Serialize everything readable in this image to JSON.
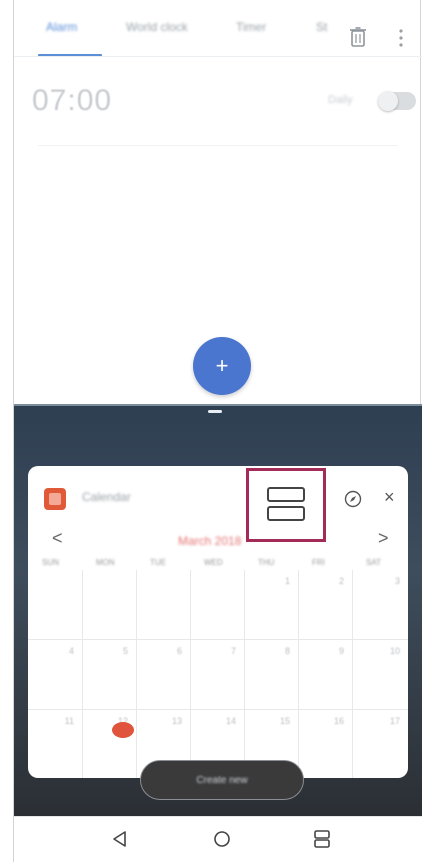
{
  "clock": {
    "tabs": [
      "Alarm",
      "World clock",
      "Timer",
      "St"
    ],
    "active_tab_index": 0,
    "alarm": {
      "time": "07:00",
      "days": "Daily",
      "enabled": false
    },
    "fab_label": "+"
  },
  "calendar_window": {
    "app_name": "Calendar",
    "month_label": "March 2018",
    "prev_label": "<",
    "next_label": ">",
    "close_label": "×",
    "weekdays": [
      "SUN",
      "MON",
      "TUE",
      "WED",
      "THU",
      "FRI",
      "SAT"
    ],
    "rows": [
      [
        "",
        "",
        "",
        "",
        "1",
        "2",
        "3"
      ],
      [
        "4",
        "5",
        "6",
        "7",
        "8",
        "9",
        "10"
      ],
      [
        "11",
        "12",
        "13",
        "14",
        "15",
        "16",
        "17"
      ]
    ],
    "create_label": "Create new"
  },
  "colors": {
    "accent_blue": "#4a76d0",
    "today_red": "#e0533c",
    "highlight_box": "#a22b57"
  },
  "icons": [
    "trash-icon",
    "more-icon",
    "toggle-switch",
    "calendar-app-icon",
    "split-view-icon",
    "compass-icon",
    "close-icon",
    "back-icon",
    "home-icon",
    "recent-apps-icon"
  ]
}
